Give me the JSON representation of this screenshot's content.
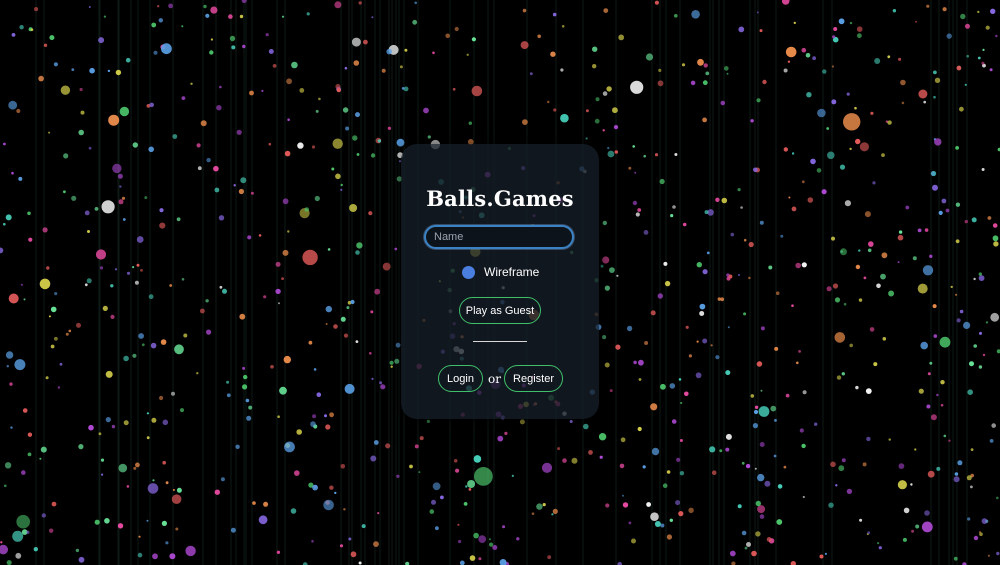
{
  "app": {
    "title": "Balls.Games"
  },
  "login": {
    "name_placeholder": "Name",
    "name_value": "",
    "wireframe_label": "Wireframe",
    "wireframe_enabled": true,
    "guest_button": "Play as Guest",
    "login_button": "Login",
    "or_text": "or",
    "register_button": "Register"
  },
  "colors": {
    "background": "#000000",
    "accent_green": "#3fbf6a",
    "input_border": "#3b82c4",
    "toggle": "#4a7fe0"
  },
  "background_scene": {
    "description_icon": "ball-field",
    "ball_palette": [
      "#e25a5a",
      "#4cc46a",
      "#5aa0e6",
      "#d6d04a",
      "#b04ad6",
      "#4ad6c0",
      "#e68a4a",
      "#e64aa0",
      "#f2f2f2",
      "#8a6ae6",
      "#6ae69a"
    ]
  }
}
